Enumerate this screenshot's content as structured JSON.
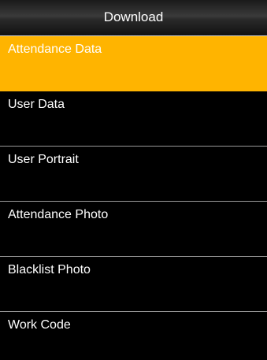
{
  "header": {
    "title": "Download"
  },
  "menu": {
    "items": [
      {
        "label": "Attendance Data",
        "selected": true
      },
      {
        "label": "User Data",
        "selected": false
      },
      {
        "label": "User Portrait",
        "selected": false
      },
      {
        "label": "Attendance Photo",
        "selected": false
      },
      {
        "label": "Blacklist Photo",
        "selected": false
      },
      {
        "label": "Work Code",
        "selected": false
      }
    ]
  },
  "colors": {
    "highlight": "#ffb400",
    "background": "#000000",
    "text": "#ffffff",
    "divider": "#9a9a9a"
  }
}
